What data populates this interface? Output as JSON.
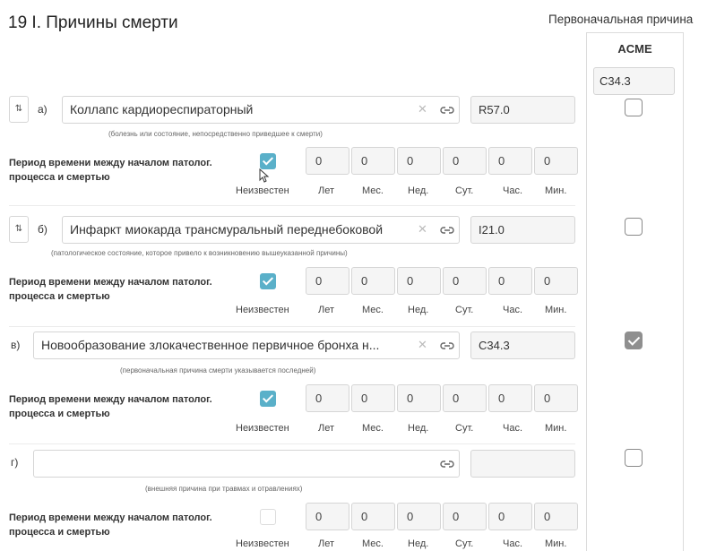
{
  "title": "19 I. Причины смерти",
  "acme": {
    "heading": "Первоначальная причина",
    "label": "ACME",
    "code": "C34.3"
  },
  "period": {
    "label": "Период времени между началом патолог. процесса и смертью",
    "units": [
      "Неизвестен",
      "Лет",
      "Мес.",
      "Нед.",
      "Сут.",
      "Час.",
      "Мин."
    ]
  },
  "rows": [
    {
      "letter": "а)",
      "diagnosis": "Коллапс кардиореспираторный",
      "code": "R57.0",
      "hint": "(болезнь или состояние, непосредственно приведшее к смерти)",
      "unknown_checked": true,
      "acme_checked": false,
      "values": [
        "0",
        "0",
        "0",
        "0",
        "0",
        "0"
      ]
    },
    {
      "letter": "б)",
      "diagnosis": "Инфаркт миокарда трансмуральный переднебоковой",
      "code": "I21.0",
      "hint": "(патологическое состояние, которое привело к возникновению вышеуказанной причины)",
      "unknown_checked": true,
      "acme_checked": false,
      "values": [
        "0",
        "0",
        "0",
        "0",
        "0",
        "0"
      ]
    },
    {
      "letter": "в)",
      "diagnosis": "Новообразование злокачественное первичное бронха н...",
      "code": "C34.3",
      "hint": "(первоначальная причина смерти указывается последней)",
      "unknown_checked": true,
      "acme_checked": true,
      "values": [
        "0",
        "0",
        "0",
        "0",
        "0",
        "0"
      ]
    },
    {
      "letter": "г)",
      "diagnosis": "",
      "code": "",
      "hint": "(внешняя причина при травмах и отравлениях)",
      "unknown_checked": false,
      "acme_checked": false,
      "values": [
        "0",
        "0",
        "0",
        "0",
        "0",
        "0"
      ]
    }
  ]
}
